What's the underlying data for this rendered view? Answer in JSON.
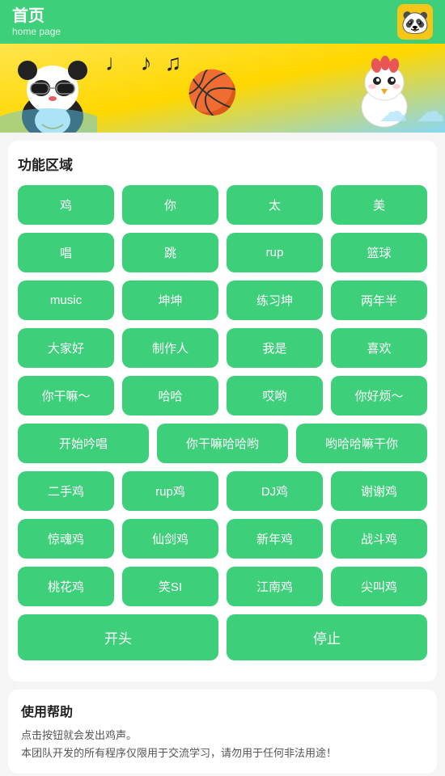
{
  "header": {
    "title": "首页",
    "subtitle": "home page",
    "avatar_emoji": "🐼"
  },
  "banner": {
    "notes": "♩♪♫♩",
    "panda_emoji": "🐼",
    "basketball_emoji": "🏀",
    "chick_emoji": "🐔"
  },
  "function_section": {
    "title": "功能区域",
    "rows": [
      {
        "type": "4col",
        "buttons": [
          "鸡",
          "你",
          "太",
          "美"
        ]
      },
      {
        "type": "4col",
        "buttons": [
          "唱",
          "跳",
          "rup",
          "篮球"
        ]
      },
      {
        "type": "4col",
        "buttons": [
          "music",
          "坤坤",
          "练习坤",
          "两年半"
        ]
      },
      {
        "type": "4col",
        "buttons": [
          "大家好",
          "制作人",
          "我是",
          "喜欢"
        ]
      },
      {
        "type": "4col",
        "buttons": [
          "你干嘛～",
          "哈哈",
          "哎哟",
          "你好烦～"
        ]
      },
      {
        "type": "3col",
        "buttons": [
          "开始吟唱",
          "你干嘛哈哈哟",
          "哟哈哈嘛干你"
        ]
      },
      {
        "type": "4col",
        "buttons": [
          "二手鸡",
          "rup鸡",
          "DJ鸡",
          "谢谢鸡"
        ]
      },
      {
        "type": "4col",
        "buttons": [
          "惊魂鸡",
          "仙剑鸡",
          "新年鸡",
          "战斗鸡"
        ]
      },
      {
        "type": "4col",
        "buttons": [
          "桃花鸡",
          "笑SI",
          "江南鸡",
          "尖叫鸡"
        ]
      }
    ],
    "action_buttons": [
      "开头",
      "停止"
    ]
  },
  "help_section": {
    "title": "使用帮助",
    "lines": [
      "点击按钮就会发出鸡声。",
      "本团队开发的所有程序仅限用于交流学习，请勿用于任何非法用途！"
    ]
  }
}
